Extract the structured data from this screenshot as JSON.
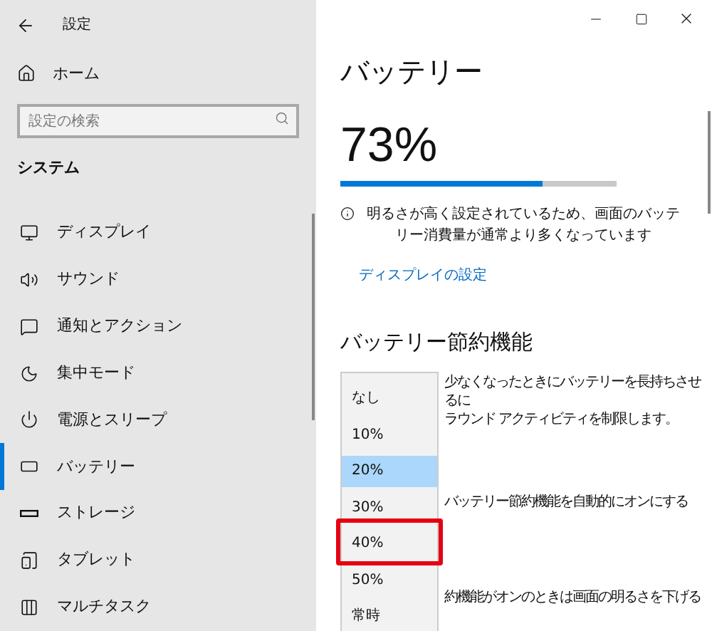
{
  "window": {
    "title": "設定"
  },
  "sidebar": {
    "home": "ホーム",
    "search": {
      "placeholder": "設定の検索"
    },
    "section": "システム",
    "items": [
      {
        "label": "ディスプレイ",
        "selected": false
      },
      {
        "label": "サウンド",
        "selected": false
      },
      {
        "label": "通知とアクション",
        "selected": false
      },
      {
        "label": "集中モード",
        "selected": false
      },
      {
        "label": "電源とスリープ",
        "selected": false
      },
      {
        "label": "バッテリー",
        "selected": true
      },
      {
        "label": "ストレージ",
        "selected": false
      },
      {
        "label": "タブレット",
        "selected": false
      },
      {
        "label": "マルチタスク",
        "selected": false
      }
    ]
  },
  "page": {
    "title": "バッテリー",
    "percent": "73%",
    "level": 0.73,
    "notice": "明るさが高く設定されているため、画面のバッテリー消費量が通常より多くなっています",
    "link": "ディスプレイの設定",
    "saver": {
      "title": "バッテリー節約機能",
      "lines": [
        "少なくなったときにバッテリーを長持ちさせるに",
        "ラウンド アクティビティを制限します。"
      ],
      "auto": "バッテリー節約機能を自動的にオンにする",
      "brightness": "約機能がオンのときは画面の明るさを下げる"
    }
  },
  "dropdown": {
    "options": [
      {
        "label": "なし",
        "selected": false,
        "highlighted": false
      },
      {
        "label": "10%",
        "selected": false,
        "highlighted": false
      },
      {
        "label": "20%",
        "selected": true,
        "highlighted": false
      },
      {
        "label": "30%",
        "selected": false,
        "highlighted": false
      },
      {
        "label": "40%",
        "selected": false,
        "highlighted": true
      },
      {
        "label": "50%",
        "selected": false,
        "highlighted": false
      },
      {
        "label": "常時",
        "selected": false,
        "highlighted": false
      }
    ]
  }
}
